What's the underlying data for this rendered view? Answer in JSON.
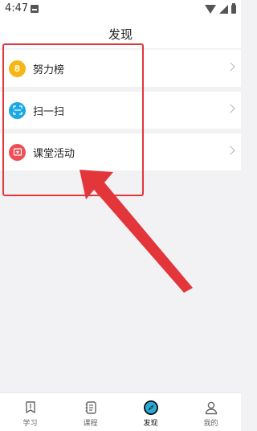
{
  "status_bar": {
    "time": "4:47"
  },
  "header": {
    "title": "发现"
  },
  "menu": {
    "items": [
      {
        "label": "努力榜",
        "icon": "medal-icon",
        "color": "#f5b718"
      },
      {
        "label": "扫一扫",
        "icon": "scan-icon",
        "color": "#1aa8e6"
      },
      {
        "label": "课堂活动",
        "icon": "star-badge-icon",
        "color": "#ef4e56"
      }
    ]
  },
  "annotation": {
    "color": "#e3363a"
  },
  "bottom_nav": {
    "active": "发现",
    "items": [
      {
        "label": "学习",
        "icon": "book-icon"
      },
      {
        "label": "课程",
        "icon": "notebook-icon"
      },
      {
        "label": "发现",
        "icon": "compass-icon"
      },
      {
        "label": "我的",
        "icon": "person-icon"
      }
    ]
  }
}
